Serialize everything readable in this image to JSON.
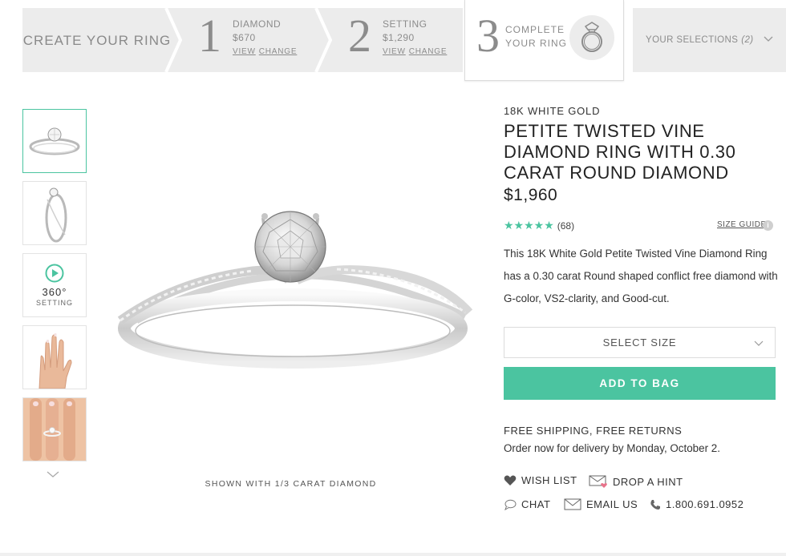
{
  "progress": {
    "create_label": "CREATE YOUR RING",
    "step1": {
      "num": "1",
      "title": "DIAMOND",
      "price": "$670",
      "view": "VIEW",
      "change": "CHANGE"
    },
    "step2": {
      "num": "2",
      "title": "SETTING",
      "price": "$1,290",
      "view": "VIEW",
      "change": "CHANGE"
    },
    "step3": {
      "num": "3",
      "line1": "COMPLETE",
      "line2": "YOUR RING",
      "icon": "ring-icon"
    },
    "selections": {
      "label": "YOUR SELECTIONS",
      "count": "(2)"
    }
  },
  "thumbnails": {
    "items": [
      "ring-front-view",
      "ring-side-view",
      "360-setting",
      "hand-view",
      "hand-closeup"
    ],
    "spin_degree": "360°",
    "spin_label": "SETTING"
  },
  "main_image": {
    "caption": "SHOWN WITH 1/3 CARAT DIAMOND"
  },
  "product": {
    "metal": "18K WHITE GOLD",
    "title": "PETITE TWISTED VINE DIAMOND RING WITH 0.30 CARAT ROUND DIAMOND",
    "price": "$1,960",
    "stars": "★★★★★",
    "rating_count": "(68)",
    "rating_value": 5,
    "size_guide": "SIZE GUIDE",
    "info_glyph": "i",
    "description": "This 18K White Gold Petite Twisted Vine Diamond Ring has a 0.30 carat Round shaped conflict free diamond with G-color, VS2-clarity, and Good-cut.",
    "select_size": "SELECT SIZE",
    "add_to_bag": "ADD TO BAG",
    "shipping_line1": "FREE SHIPPING, FREE RETURNS",
    "shipping_line2": "Order now for delivery by Monday, October 2."
  },
  "actions": {
    "wish_list": "WISH LIST",
    "drop_hint": "DROP A HINT",
    "chat": "CHAT",
    "email": "EMAIL US",
    "phone": "1.800.691.0952"
  },
  "colors": {
    "accent": "#4bc4a0",
    "step_bg": "#ececec",
    "muted_text": "#8c8c8c",
    "hint_heart": "#e8728a"
  }
}
